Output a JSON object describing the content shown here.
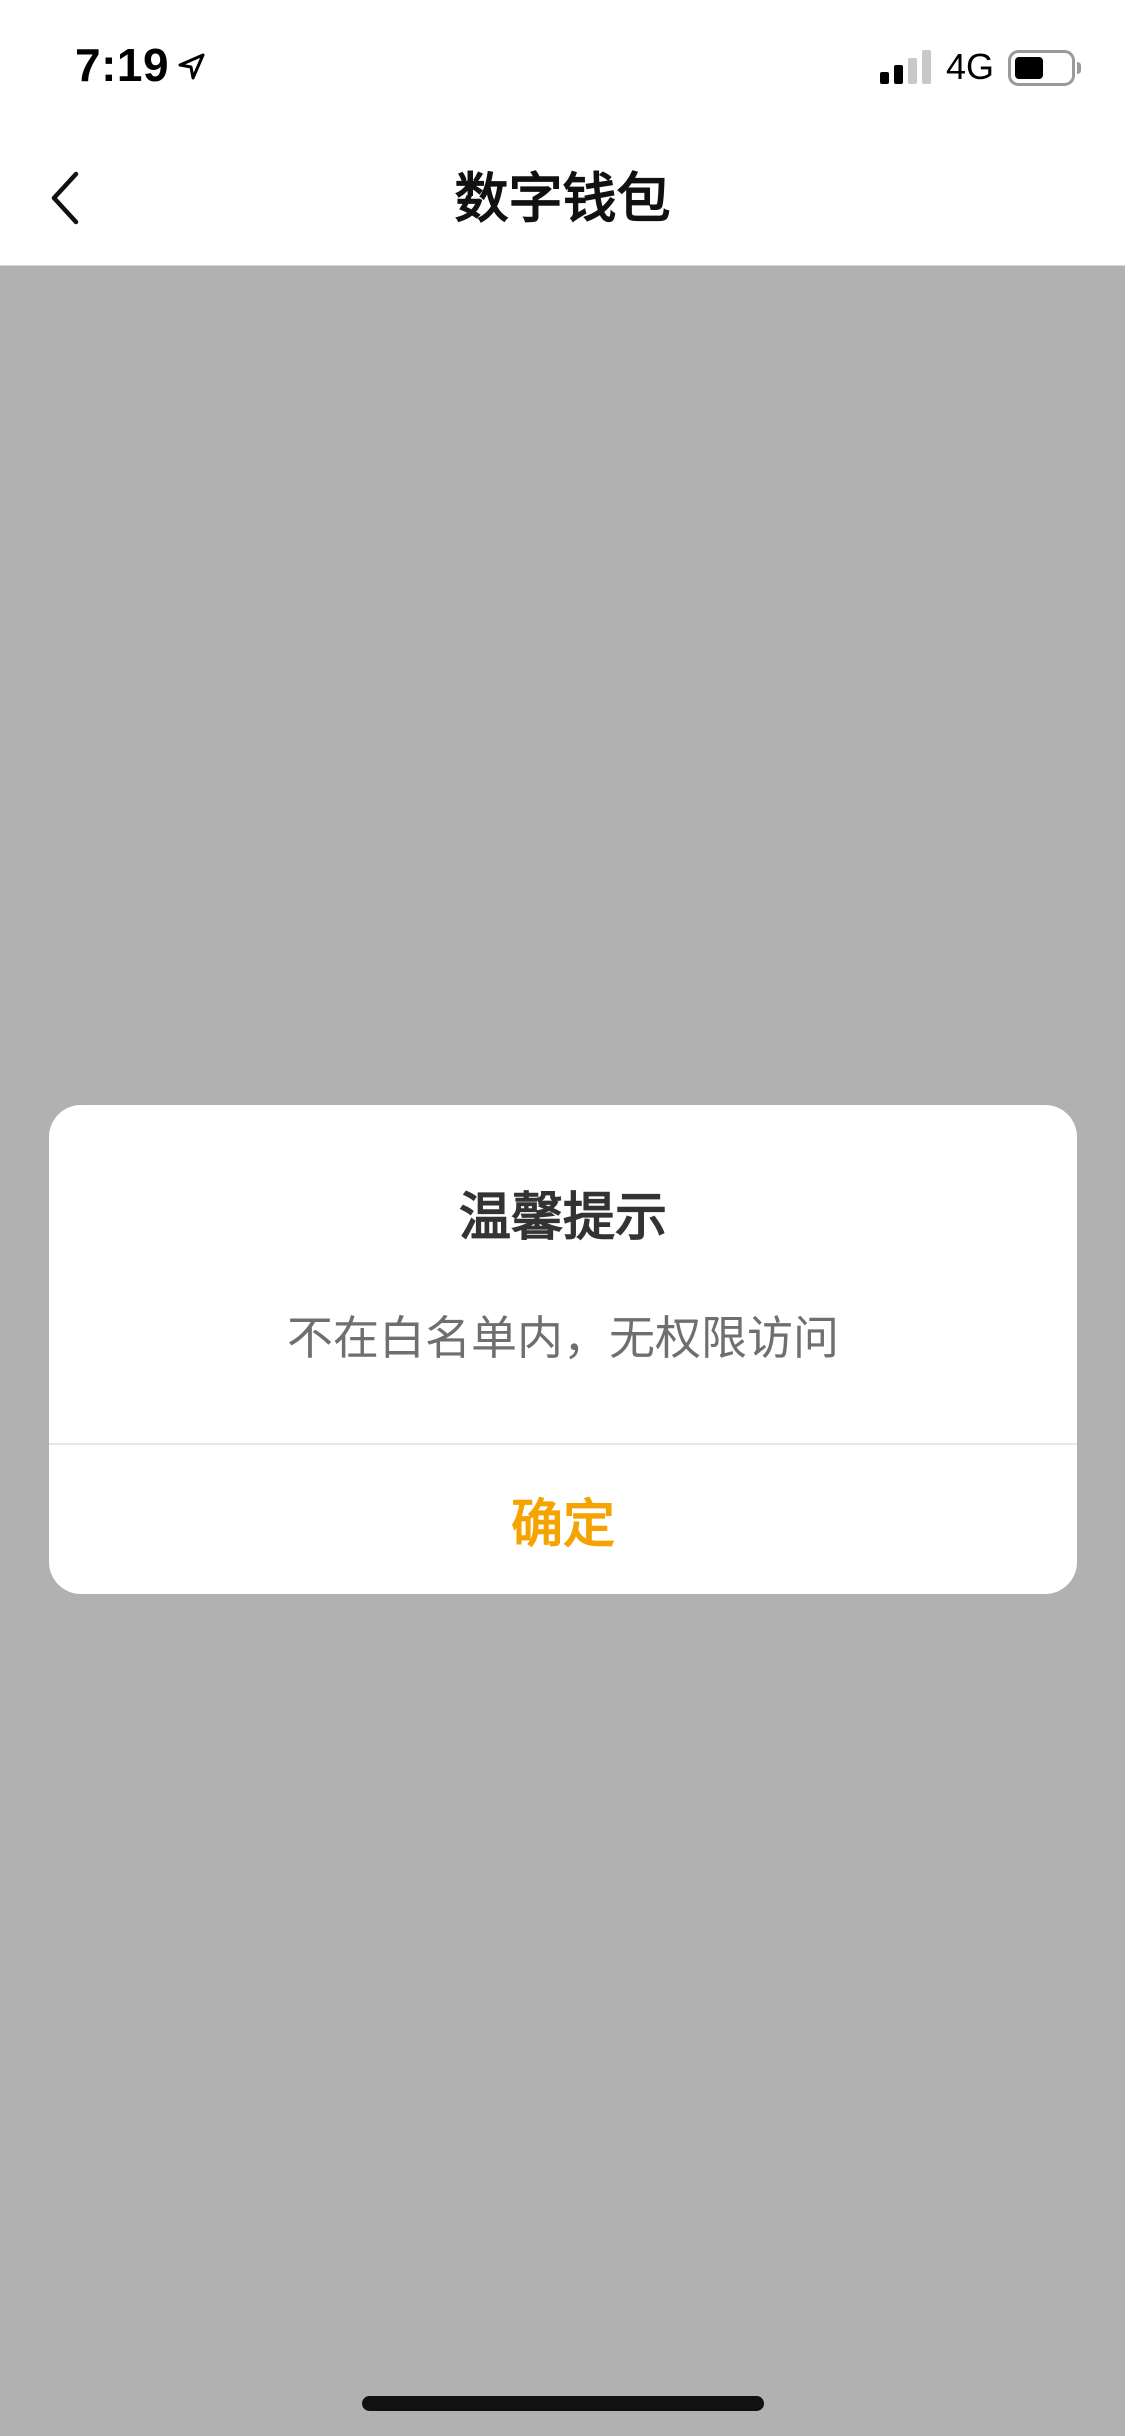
{
  "status_bar": {
    "time": "7:19",
    "network": "4G",
    "icons": {
      "location": "location-arrow-icon",
      "signal": "cellular-signal-icon",
      "battery": "battery-icon"
    },
    "signal_bars_active": 2,
    "signal_bars_total": 4,
    "battery_level": 0.5
  },
  "nav_bar": {
    "title": "数字钱包",
    "back_icon": "chevron-left-icon"
  },
  "dialog": {
    "title": "温馨提示",
    "message": "不在白名单内，无权限访问",
    "confirm_label": "确定"
  },
  "colors": {
    "overlay": "#b1b1b1",
    "accent": "#f5a300",
    "title_text": "#333333",
    "message_text": "#6f6f6f"
  }
}
